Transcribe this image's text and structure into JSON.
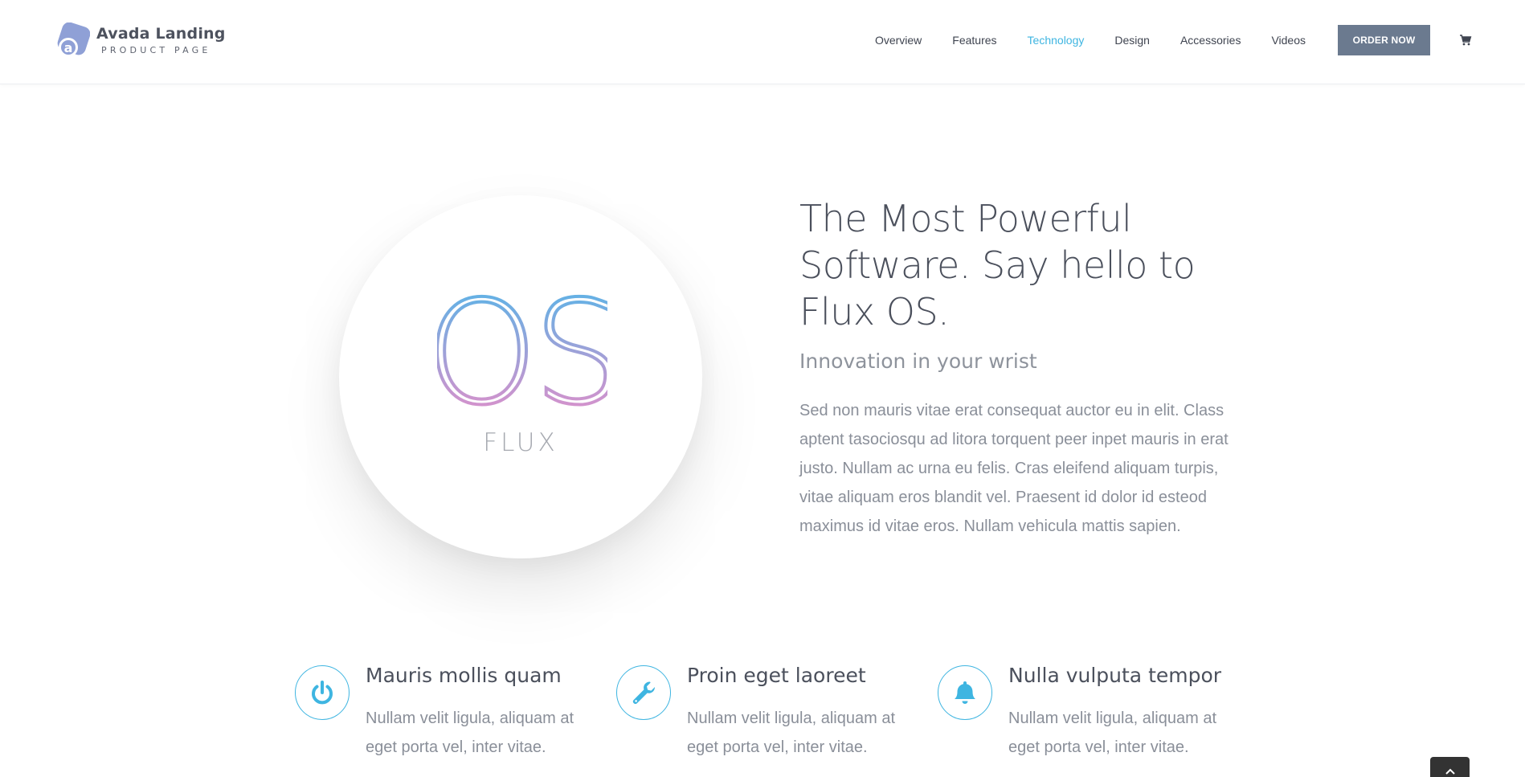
{
  "header": {
    "logo": {
      "title": "Avada Landing",
      "subtitle": "PRODUCT PAGE",
      "mark_letter": "a"
    },
    "nav": [
      {
        "label": "Overview",
        "active": false
      },
      {
        "label": "Features",
        "active": false
      },
      {
        "label": "Technology",
        "active": true
      },
      {
        "label": "Design",
        "active": false
      },
      {
        "label": "Accessories",
        "active": false
      },
      {
        "label": "Videos",
        "active": false
      }
    ],
    "order_button": "ORDER NOW",
    "cart_icon": "shopping-cart-icon"
  },
  "hero": {
    "emblem_text": "OS",
    "brand": "FLUX",
    "title": "The Most Powerful Software. Say hello to Flux OS.",
    "subtitle": "Innovation in your wrist",
    "body": "Sed non mauris vitae erat consequat auctor eu in elit. Class aptent tasociosqu ad litora torquent peer inpet mauris in erat justo. Nullam ac urna eu felis. Cras eleifend aliquam turpis, vitae aliquam eros blandit vel. Praesent id dolor id esteod maximus id vitae eros. Nullam vehicula mattis sapien."
  },
  "features": [
    {
      "icon": "power-icon",
      "title": "Mauris mollis quam",
      "text": "Nullam velit ligula, aliquam at eget porta vel, inter vitae."
    },
    {
      "icon": "wrench-icon",
      "title": "Proin eget laoreet",
      "text": "Nullam velit ligula, aliquam at eget porta vel, inter vitae."
    },
    {
      "icon": "bell-icon",
      "title": "Nulla vulputa tempor",
      "text": "Nullam velit ligula, aliquam at eget porta vel, inter vitae."
    }
  ],
  "scroll_to_top_icon": "chevron-up-icon",
  "colors": {
    "accent": "#3eb5e1",
    "button": "#6b7a8f",
    "gradient_top": "#4cb8ea",
    "gradient_bottom": "#f08ac6"
  }
}
